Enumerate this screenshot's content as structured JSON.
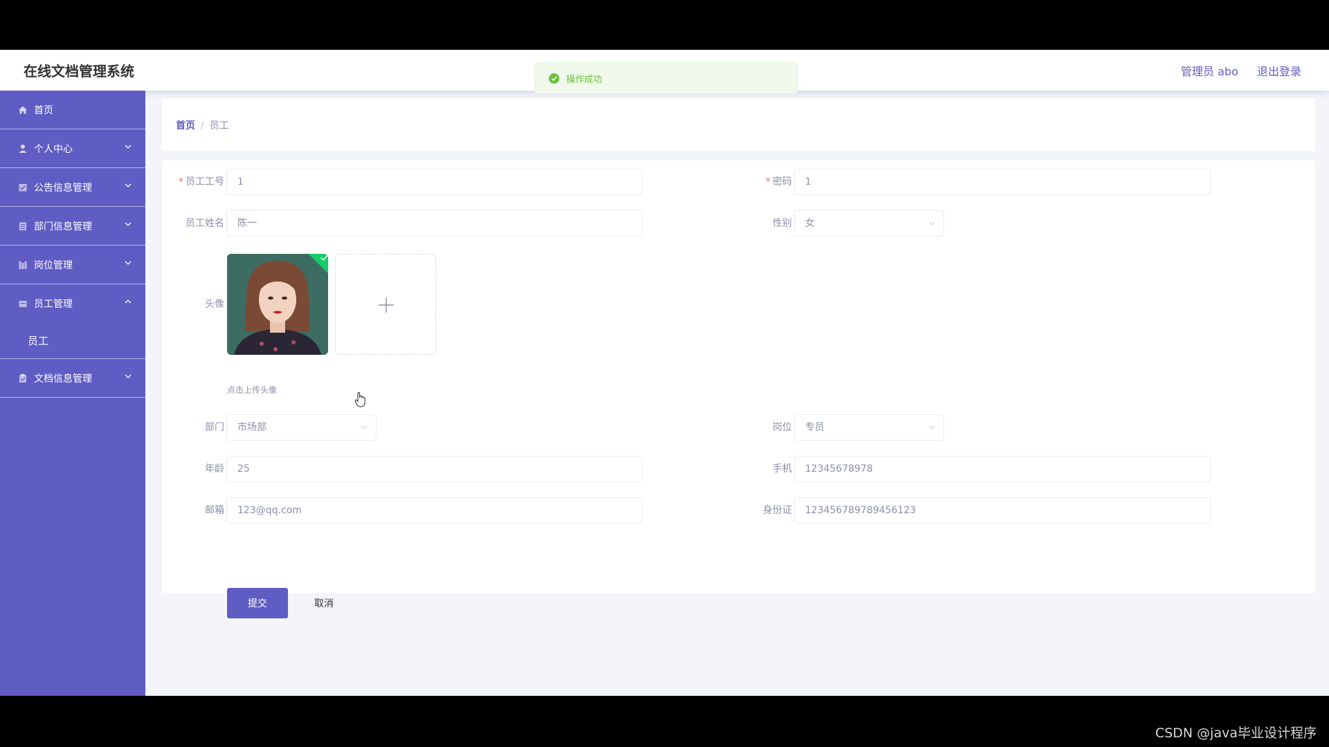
{
  "app": {
    "title": "在线文档管理系统",
    "user_label": "管理员 abo",
    "logout_label": "退出登录"
  },
  "toast": {
    "message": "操作成功",
    "type": "success"
  },
  "sidebar": {
    "items": [
      {
        "label": "首页",
        "icon": "home-icon"
      },
      {
        "label": "个人中心",
        "icon": "user-icon"
      },
      {
        "label": "公告信息管理",
        "icon": "notice-icon"
      },
      {
        "label": "部门信息管理",
        "icon": "department-icon"
      },
      {
        "label": "岗位管理",
        "icon": "position-icon"
      },
      {
        "label": "员工管理",
        "icon": "employee-icon",
        "expanded": true,
        "children": [
          {
            "label": "员工"
          }
        ]
      },
      {
        "label": "文档信息管理",
        "icon": "document-icon"
      }
    ]
  },
  "breadcrumb": {
    "home": "首页",
    "separator": "/",
    "current": "员工"
  },
  "form": {
    "employee_no": {
      "label": "员工工号",
      "value": "1",
      "required": true
    },
    "password": {
      "label": "密码",
      "value": "1",
      "required": true
    },
    "name": {
      "label": "员工姓名",
      "value": "陈一"
    },
    "gender": {
      "label": "性别",
      "value": "女"
    },
    "avatar": {
      "label": "头像",
      "tip": "点击上传头像"
    },
    "department": {
      "label": "部门",
      "value": "市场部"
    },
    "position": {
      "label": "岗位",
      "value": "专员"
    },
    "age": {
      "label": "年龄",
      "value": "25"
    },
    "phone": {
      "label": "手机",
      "value": "12345678978"
    },
    "email": {
      "label": "邮箱",
      "value": "123@qq.com"
    },
    "id_card": {
      "label": "身份证",
      "value": "123456789789456123"
    },
    "submit_label": "提交",
    "cancel_label": "取消"
  },
  "watermark": "CSDN @java毕业设计程序",
  "colors": {
    "primary": "#5f5cc4",
    "success": "#67c23a",
    "badge": "#13ce66"
  }
}
